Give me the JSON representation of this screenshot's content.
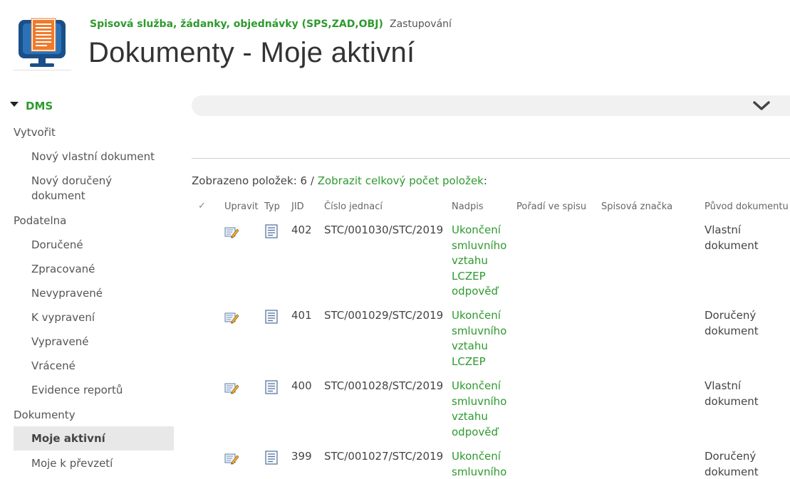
{
  "header": {
    "site_title": "Spisová služba, žádanky, objednávky (SPS,ZAD,OBJ)",
    "zastupovani": "Zastupování",
    "page_title": "Dokumenty - Moje aktivní"
  },
  "nav": {
    "root": "DMS",
    "vytvorit": "Vytvořit",
    "novy_vlastni": "Nový vlastní dokument",
    "novy_doruceny_1": "Nový doručený",
    "novy_doruceny_2": "dokument",
    "podatelna": "Podatelna",
    "dorucene": "Doručené",
    "zpracovane": "Zpracované",
    "nevypravene": "Nevypravené",
    "k_vypraveni": "K vypravení",
    "vypravene": "Vypravené",
    "vracene": "Vrácené",
    "evidence": "Evidence reportů",
    "dokumenty": "Dokumenty",
    "moje_aktivni": "Moje aktivní",
    "moje_k_prevzeti": "Moje k převzetí"
  },
  "list": {
    "count_prefix": "Zobrazeno položek: 6 / ",
    "count_link": "Zobrazit celkový počet položek",
    "count_suffix": ":",
    "columns": {
      "check": "✓",
      "upravit": "Upravit",
      "typ": "Typ",
      "jid": "JID",
      "cislo": "Číslo jednací",
      "nadpis": "Nadpis",
      "poradi": "Pořadí ve spisu",
      "znacka": "Spisová značka",
      "puvod": "Původ dokumentu"
    },
    "rows": [
      {
        "jid": "402",
        "cislo": "STC/001030/STC/2019",
        "nadpis": [
          "Ukončení",
          "smluvního",
          "vztahu",
          "LCZEP",
          "odpověď"
        ],
        "puvod": [
          "Vlastní",
          "dokument"
        ]
      },
      {
        "jid": "401",
        "cislo": "STC/001029/STC/2019",
        "nadpis": [
          "Ukončení",
          "smluvního",
          "vztahu",
          "LCZEP"
        ],
        "puvod": [
          "Doručený",
          "dokument"
        ]
      },
      {
        "jid": "400",
        "cislo": "STC/001028/STC/2019",
        "nadpis": [
          "Ukončení",
          "smluvního",
          "vztahu",
          "odpověď"
        ],
        "puvod": [
          "Vlastní",
          "dokument"
        ]
      },
      {
        "jid": "399",
        "cislo": "STC/001027/STC/2019",
        "nadpis": [
          "Ukončení",
          "smluvního"
        ],
        "puvod": [
          "Doručený",
          "dokument"
        ]
      }
    ]
  },
  "colors": {
    "accent": "#2e9a2e",
    "text": "#444444",
    "logo_blue": "#1a4f8a",
    "logo_orange": "#f07a2a"
  },
  "icons": {
    "logo": "monitor-document-icon",
    "edit": "edit-pencil-icon",
    "type": "document-type-icon",
    "chevron": "chevron-down-icon"
  }
}
